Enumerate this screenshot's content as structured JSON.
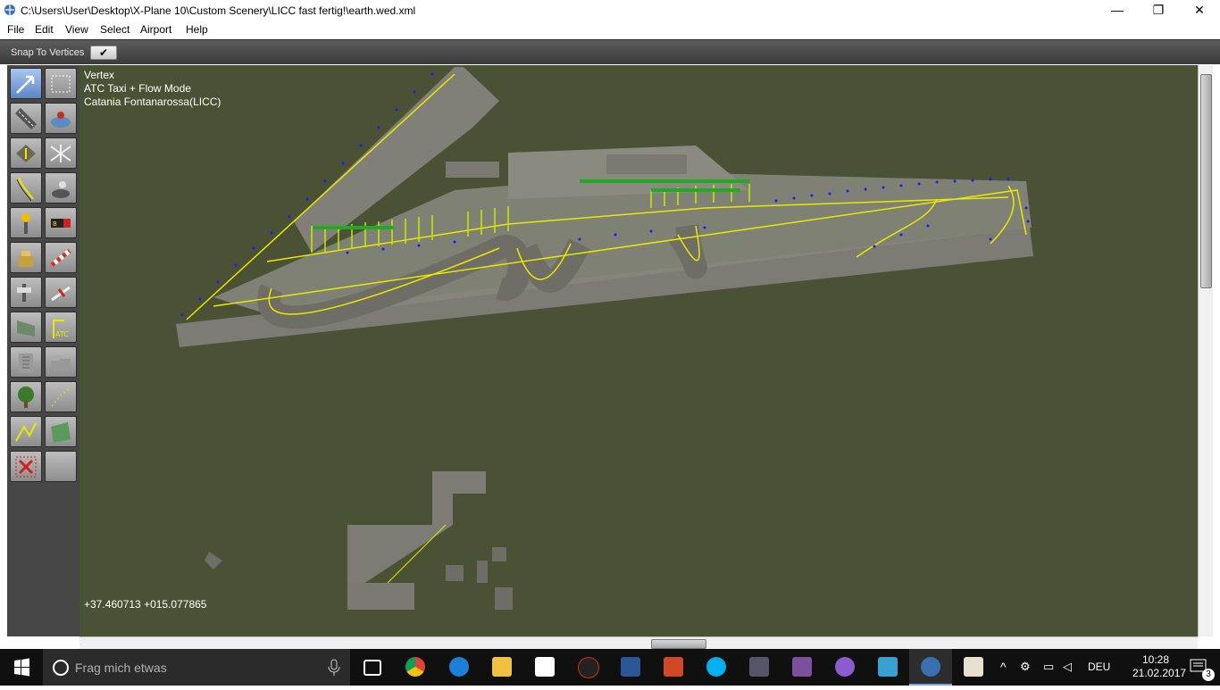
{
  "window": {
    "title": "C:\\Users\\User\\Desktop\\X-Plane 10\\Custom Scenery\\LICC fast fertig!\\earth.wed.xml",
    "minimize": "—",
    "restore": "❐",
    "close": "✕"
  },
  "menu": [
    "File",
    "Edit",
    "View",
    "Select",
    "Airport",
    "Help"
  ],
  "snap": {
    "label": "Snap To Vertices",
    "check": "✔"
  },
  "tools": [
    {
      "name": "vertex-tool",
      "icon": "arrow-icon",
      "active": true
    },
    {
      "name": "marquee-tool",
      "icon": "marquee-icon"
    },
    {
      "name": "runway-tool",
      "icon": "runway-icon"
    },
    {
      "name": "helipad-tool",
      "icon": "helipad-icon"
    },
    {
      "name": "taxiway-tool",
      "icon": "taxiway-icon"
    },
    {
      "name": "boundary-tool",
      "icon": "boundary-icon"
    },
    {
      "name": "taxiline-tool",
      "icon": "taxiline-icon"
    },
    {
      "name": "light-tool",
      "icon": "light-icon"
    },
    {
      "name": "beacon-tool",
      "icon": "beacon-icon"
    },
    {
      "name": "sign-tool",
      "icon": "sign-icon"
    },
    {
      "name": "tower-tool",
      "icon": "tower-icon"
    },
    {
      "name": "windsock-tool",
      "icon": "windsock-icon"
    },
    {
      "name": "ramp-start-tool",
      "icon": "ramp-start-icon"
    },
    {
      "name": "atc-tool",
      "icon": "atc-icon"
    },
    {
      "name": "facade-tool",
      "icon": "facade-icon"
    },
    {
      "name": "atc-route-tool",
      "icon": "atc-route-icon"
    },
    {
      "name": "object-tool",
      "icon": "building-icon"
    },
    {
      "name": "object-string-tool",
      "icon": "buildings-icon"
    },
    {
      "name": "forest-tool",
      "icon": "tree-icon"
    },
    {
      "name": "line-tool",
      "icon": "dotted-line-icon"
    },
    {
      "name": "polygon-line-tool",
      "icon": "line-icon"
    },
    {
      "name": "draped-poly-tool",
      "icon": "polygon-icon"
    },
    {
      "name": "exclusion-tool",
      "icon": "exclusion-icon"
    },
    {
      "name": "empty-tool",
      "icon": "blank-icon"
    }
  ],
  "overlay": {
    "tool": "Vertex",
    "mode": "ATC Taxi + Flow Mode",
    "airport": "Catania Fontanarossa(LICC)",
    "coords": "+37.460713 +015.077865"
  },
  "taskbar": {
    "search_placeholder": "Frag mich etwas",
    "apps": [
      "task-view",
      "chrome",
      "edge",
      "file-explorer",
      "store",
      "app-a",
      "word",
      "powerpoint",
      "skype",
      "game-1",
      "viber",
      "app-cat",
      "game-2",
      "wed",
      "java"
    ],
    "language": "DEU",
    "time": "10:28",
    "date": "21.02.2017",
    "notifications": "3"
  },
  "colors": {
    "map_bg": "#4a5134",
    "tarmac": "#7a7a72",
    "taxiline": "#e8e800",
    "edge_light": "#1a1aff",
    "toolbar_bg": "#474747",
    "taskbar_bg": "#101010"
  }
}
